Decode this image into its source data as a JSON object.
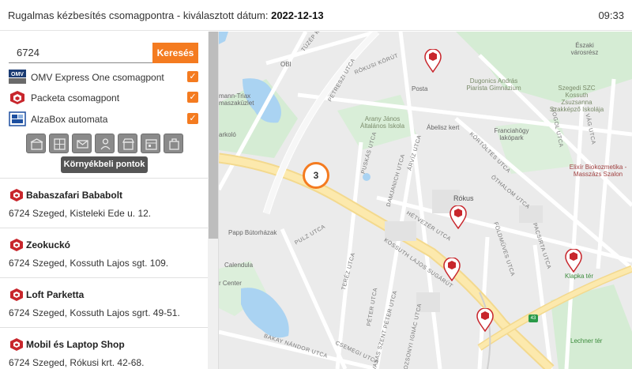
{
  "header": {
    "title_prefix": "Rugalmas kézbesítés csomagpontra - kiválasztott dátum: ",
    "date": "2022-12-13",
    "time": "09:33"
  },
  "search": {
    "value": "6724",
    "button_label": "Keresés"
  },
  "filters": [
    {
      "label": "OMV Express One csomagpont",
      "logo": "omv-logo",
      "checked": true
    },
    {
      "label": "Packeta csomagpont",
      "logo": "packeta-logo",
      "checked": true
    },
    {
      "label": "AlzaBox automata",
      "logo": "alzabox-logo",
      "checked": true
    }
  ],
  "type_icons": [
    "parcel-shop-icon",
    "locker-icon",
    "post-office-icon",
    "courier-icon",
    "store-icon",
    "calendar-box-icon",
    "pickup-icon"
  ],
  "nearby_button": "Környékbeli pontok",
  "list": [
    {
      "name": "Babaszafari Bababolt",
      "address": "6724 Szeged, Kisteleki Ede u. 12."
    },
    {
      "name": "Zeokuckó",
      "address": "6724 Szeged, Kossuth Lajos sgt. 109."
    },
    {
      "name": "Loft Parketta",
      "address": "6724 Szeged, Kossuth Lajos sgrt. 49-51."
    },
    {
      "name": "Mobil és Laptop Shop",
      "address": "6724 Szeged, Rókusi krt. 42-68."
    }
  ],
  "map": {
    "cluster_count": "3",
    "road_number": "43",
    "places": [
      "Északi városrész",
      "OBI",
      "Posta",
      "Dugonics András Piarista Gimnázium",
      "Szegedi SZC Kossuth Zsuzsanna Szakképző Iskolája",
      "Arany János Általános Iskola",
      "Ábelisz kert",
      "Franciahögy lakópark",
      "Elixír Biokozmetika - Masszázs Szalon",
      "Rókus",
      "Papp Bútorházak",
      "Calendula",
      "Klapka tér",
      "Lechner tér",
      "mann-Triax",
      "maszaküzlet",
      "arkoló",
      "r Center"
    ],
    "streets": [
      "TÚZÉP KÖZ",
      "RÓKUSI KÖRÚT",
      "PETRESZI UTCA",
      "GOGOL UTCA",
      "VÁG UTCA",
      "PUSKÁS UTCA",
      "ÁRVÍZ UTCA",
      "KÖRTÖLTÉS UTCA",
      "DAMJANICH UTCA",
      "ÖTHALOM UTCA",
      "HÉTVEZÉR UTCA",
      "PULZ UTCA",
      "KOSSUTH LAJOS SUGÁRÚT",
      "FÖLDMŰVES UTCA",
      "PACSIRTA UTCA",
      "TERÉZ UTCA",
      "PÉTER UTCA",
      "VASAS SZENT PÉTER UTCA",
      "POZSONYI IGNÁC UTCA",
      "BAKAY NÁNDOR UTCA",
      "CSEMEGI UTCA"
    ]
  },
  "colors": {
    "accent": "#f47b20",
    "pin": "#c8262c",
    "button_dark": "#555555"
  }
}
